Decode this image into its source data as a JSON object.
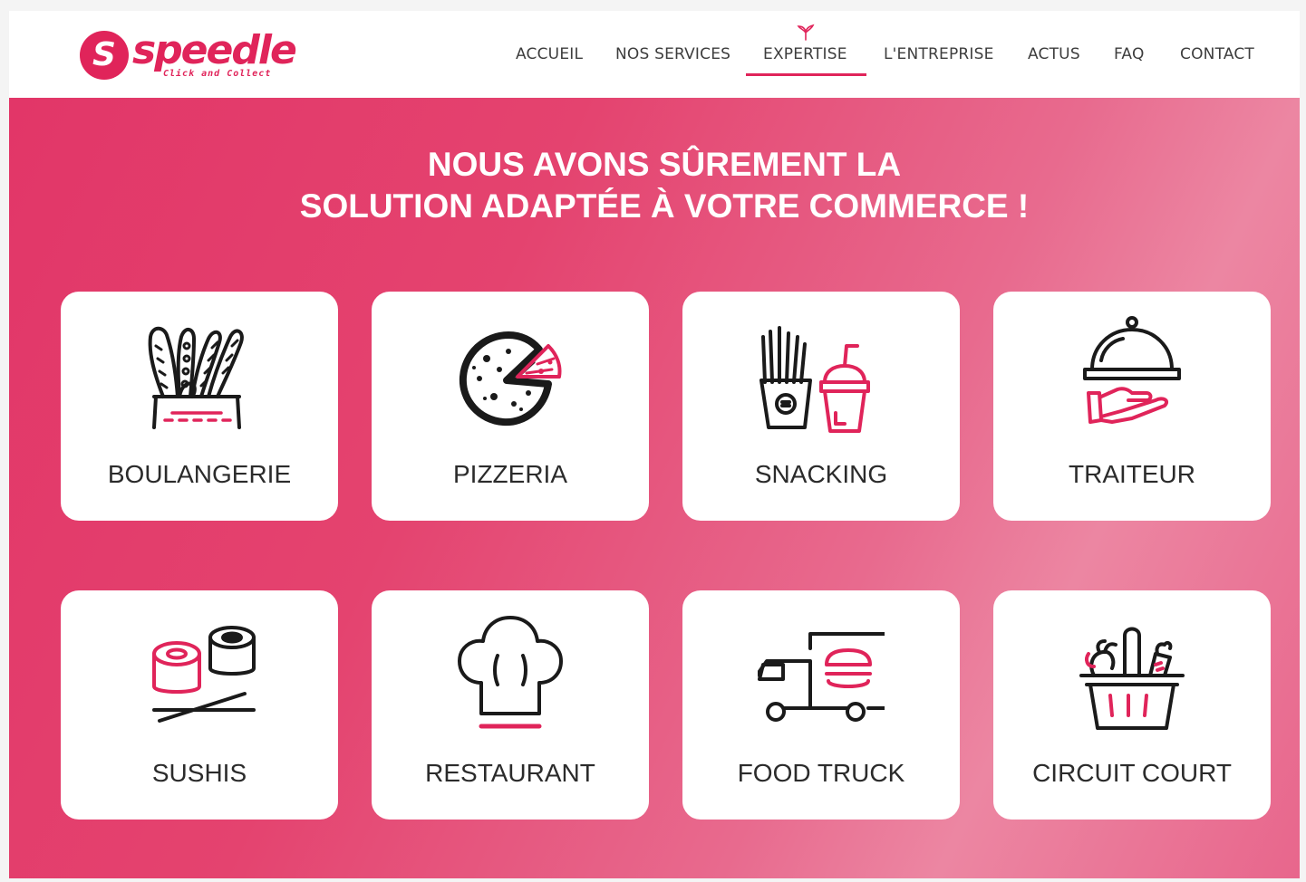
{
  "brand": {
    "name": "speedle",
    "tagline": "Click and Collect",
    "logo_letter": "S",
    "accent": "#e0245a"
  },
  "nav": {
    "items": [
      {
        "label": "ACCUEIL"
      },
      {
        "label": "NOS SERVICES"
      },
      {
        "label": "EXPERTISE",
        "active": true
      },
      {
        "label": "L'ENTREPRISE"
      },
      {
        "label": "ACTUS"
      },
      {
        "label": "FAQ"
      },
      {
        "label": "CONTACT"
      }
    ]
  },
  "hero": {
    "headline_line1": "NOUS AVONS SÛREMENT LA",
    "headline_line2": "SOLUTION ADAPTÉE À VOTRE COMMERCE !"
  },
  "cards": [
    {
      "label": "BOULANGERIE",
      "icon": "bread-basket-icon"
    },
    {
      "label": "PIZZERIA",
      "icon": "pizza-icon"
    },
    {
      "label": "SNACKING",
      "icon": "fries-drink-icon"
    },
    {
      "label": "TRAITEUR",
      "icon": "cloche-hand-icon"
    },
    {
      "label": "SUSHIS",
      "icon": "sushi-chopsticks-icon"
    },
    {
      "label": "RESTAURANT",
      "icon": "chef-hat-icon"
    },
    {
      "label": "FOOD TRUCK",
      "icon": "food-truck-icon"
    },
    {
      "label": "CIRCUIT COURT",
      "icon": "vegetable-basket-icon"
    }
  ],
  "colors": {
    "pink": "#e0245a",
    "icon_stroke": "#1a1a1a",
    "card_text": "#2b2b2b"
  }
}
